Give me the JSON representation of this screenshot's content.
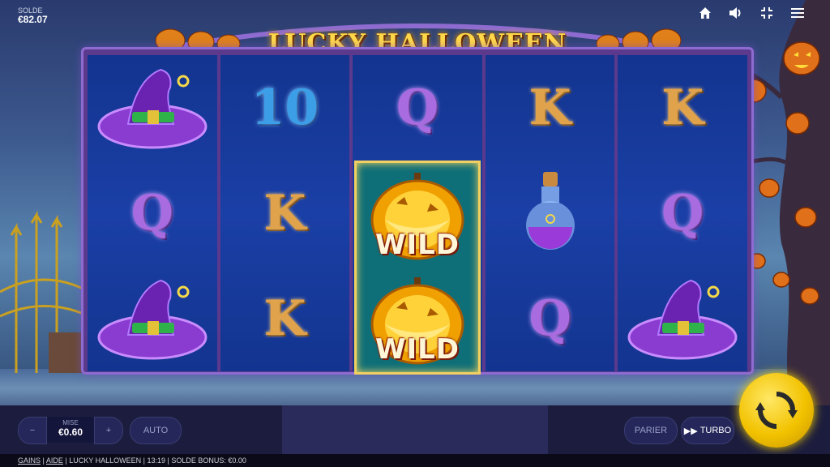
{
  "game": {
    "title": "LUCKY HALLOWEEN"
  },
  "balance": {
    "label": "SOLDE",
    "value": "€82.07"
  },
  "top_icons": [
    "home-icon",
    "sound-icon",
    "fullscreen-icon",
    "menu-icon"
  ],
  "reels": [
    [
      "witch-hat",
      "Q",
      "witch-hat"
    ],
    [
      "10",
      "K",
      "K"
    ],
    [
      "Q",
      "WILD",
      "WILD"
    ],
    [
      "K",
      "potion",
      "Q"
    ],
    [
      "K",
      "Q",
      "witch-hat"
    ]
  ],
  "wild": {
    "label": "WILD"
  },
  "bet": {
    "label": "MISE",
    "value": "€0.60",
    "minus": "−",
    "plus": "+"
  },
  "controls": {
    "auto": "AUTO",
    "parier": "PARIER",
    "turbo": "TURBO"
  },
  "footer": {
    "gains": "GAINS",
    "aide": "AIDE",
    "game_name": "LUCKY HALLOWEEN",
    "time": "13:19",
    "bonus_balance": "SOLDE BONUS: €0.00"
  },
  "colors": {
    "accent": "#f2c200",
    "title": "#ffd84a",
    "reel_bg": "#1a3fa6",
    "frame": "#5b3a8e"
  }
}
